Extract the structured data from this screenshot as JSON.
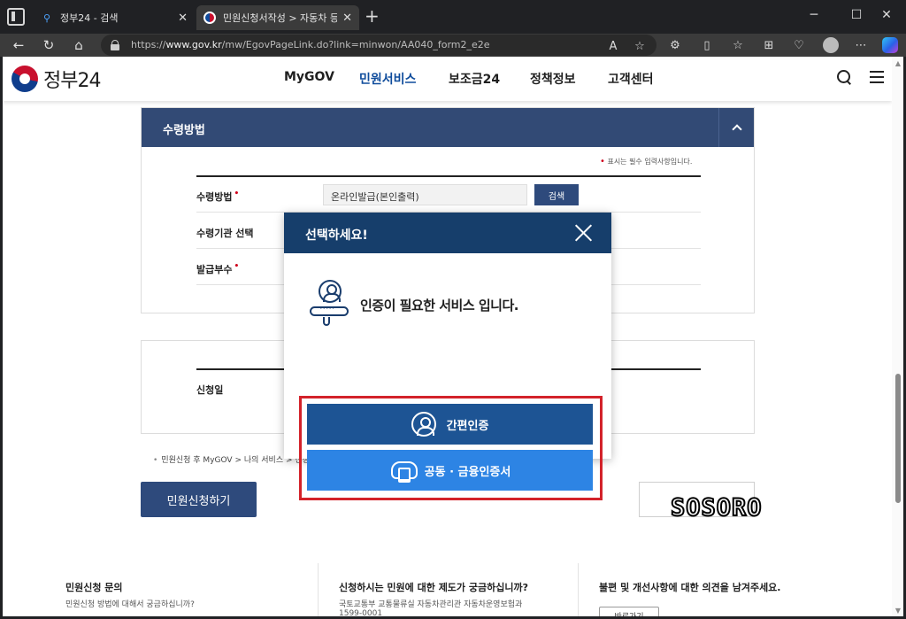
{
  "browser": {
    "tabs": [
      {
        "title": "정부24 - 검색",
        "favicon": "search-icon"
      },
      {
        "title": "민원신청서작성 > 자동차 등록원부",
        "favicon": "gov-logo-icon"
      }
    ],
    "url_prefix": "https://",
    "url_host": "www.gov.kr",
    "url_path": "/mw/EgovPageLink.do?link=minwon/AA040_form2_e2e"
  },
  "site": {
    "logo_text": "정부24",
    "nav": [
      {
        "label": "MyGOV",
        "active": false
      },
      {
        "label": "민원서비스",
        "active": true
      },
      {
        "label": "보조금24",
        "active": false
      },
      {
        "label": "정책정보",
        "active": false
      },
      {
        "label": "고객센터",
        "active": false
      }
    ]
  },
  "form": {
    "section_title": "수령방법",
    "required_note": "표시는 필수 입력사항입니다.",
    "rows": [
      {
        "label": "수령방법",
        "required": true,
        "value": "온라인발급(본인출력)"
      },
      {
        "label": "수령기관 선택",
        "required": false,
        "value": ""
      },
      {
        "label": "발급부수",
        "required": true,
        "value": ""
      }
    ],
    "search_button": "검색",
    "section2_label": "신청일"
  },
  "notice": "민원신청 후 MyGOV > 나의 서비스 > 신청내역에서 확인하실 수 있습니다.",
  "actions": {
    "apply_label": "민원신청하기",
    "cancel_label": ""
  },
  "watermark": "SOSORO",
  "footer": [
    {
      "title": "민원신청 문의",
      "sub": "민원신청 방법에 대해서 궁금하십니까?",
      "sub2": ""
    },
    {
      "title": "신청하시는 민원에 대한 제도가 궁금하십니까?",
      "sub": "국토교통부 교통물류실 자동차관리관 자동차운영보험과",
      "sub2": "1599-0001"
    },
    {
      "title": "불편 및 개선사항에 대한 의견을 남겨주세요.",
      "sub": "",
      "sub2": "",
      "button": "바로가기"
    }
  ],
  "modal": {
    "title": "선택하세요!",
    "message": "인증이 필요한 서비스 입니다.",
    "simple_auth_label": "간편인증",
    "cert_label": "공동 · 금융인증서"
  },
  "colors": {
    "navy": "#163e6b",
    "panel_head": "#324a75",
    "simple_button": "#1d5494",
    "cert_button": "#2d84e4",
    "highlight": "#d3222a"
  }
}
